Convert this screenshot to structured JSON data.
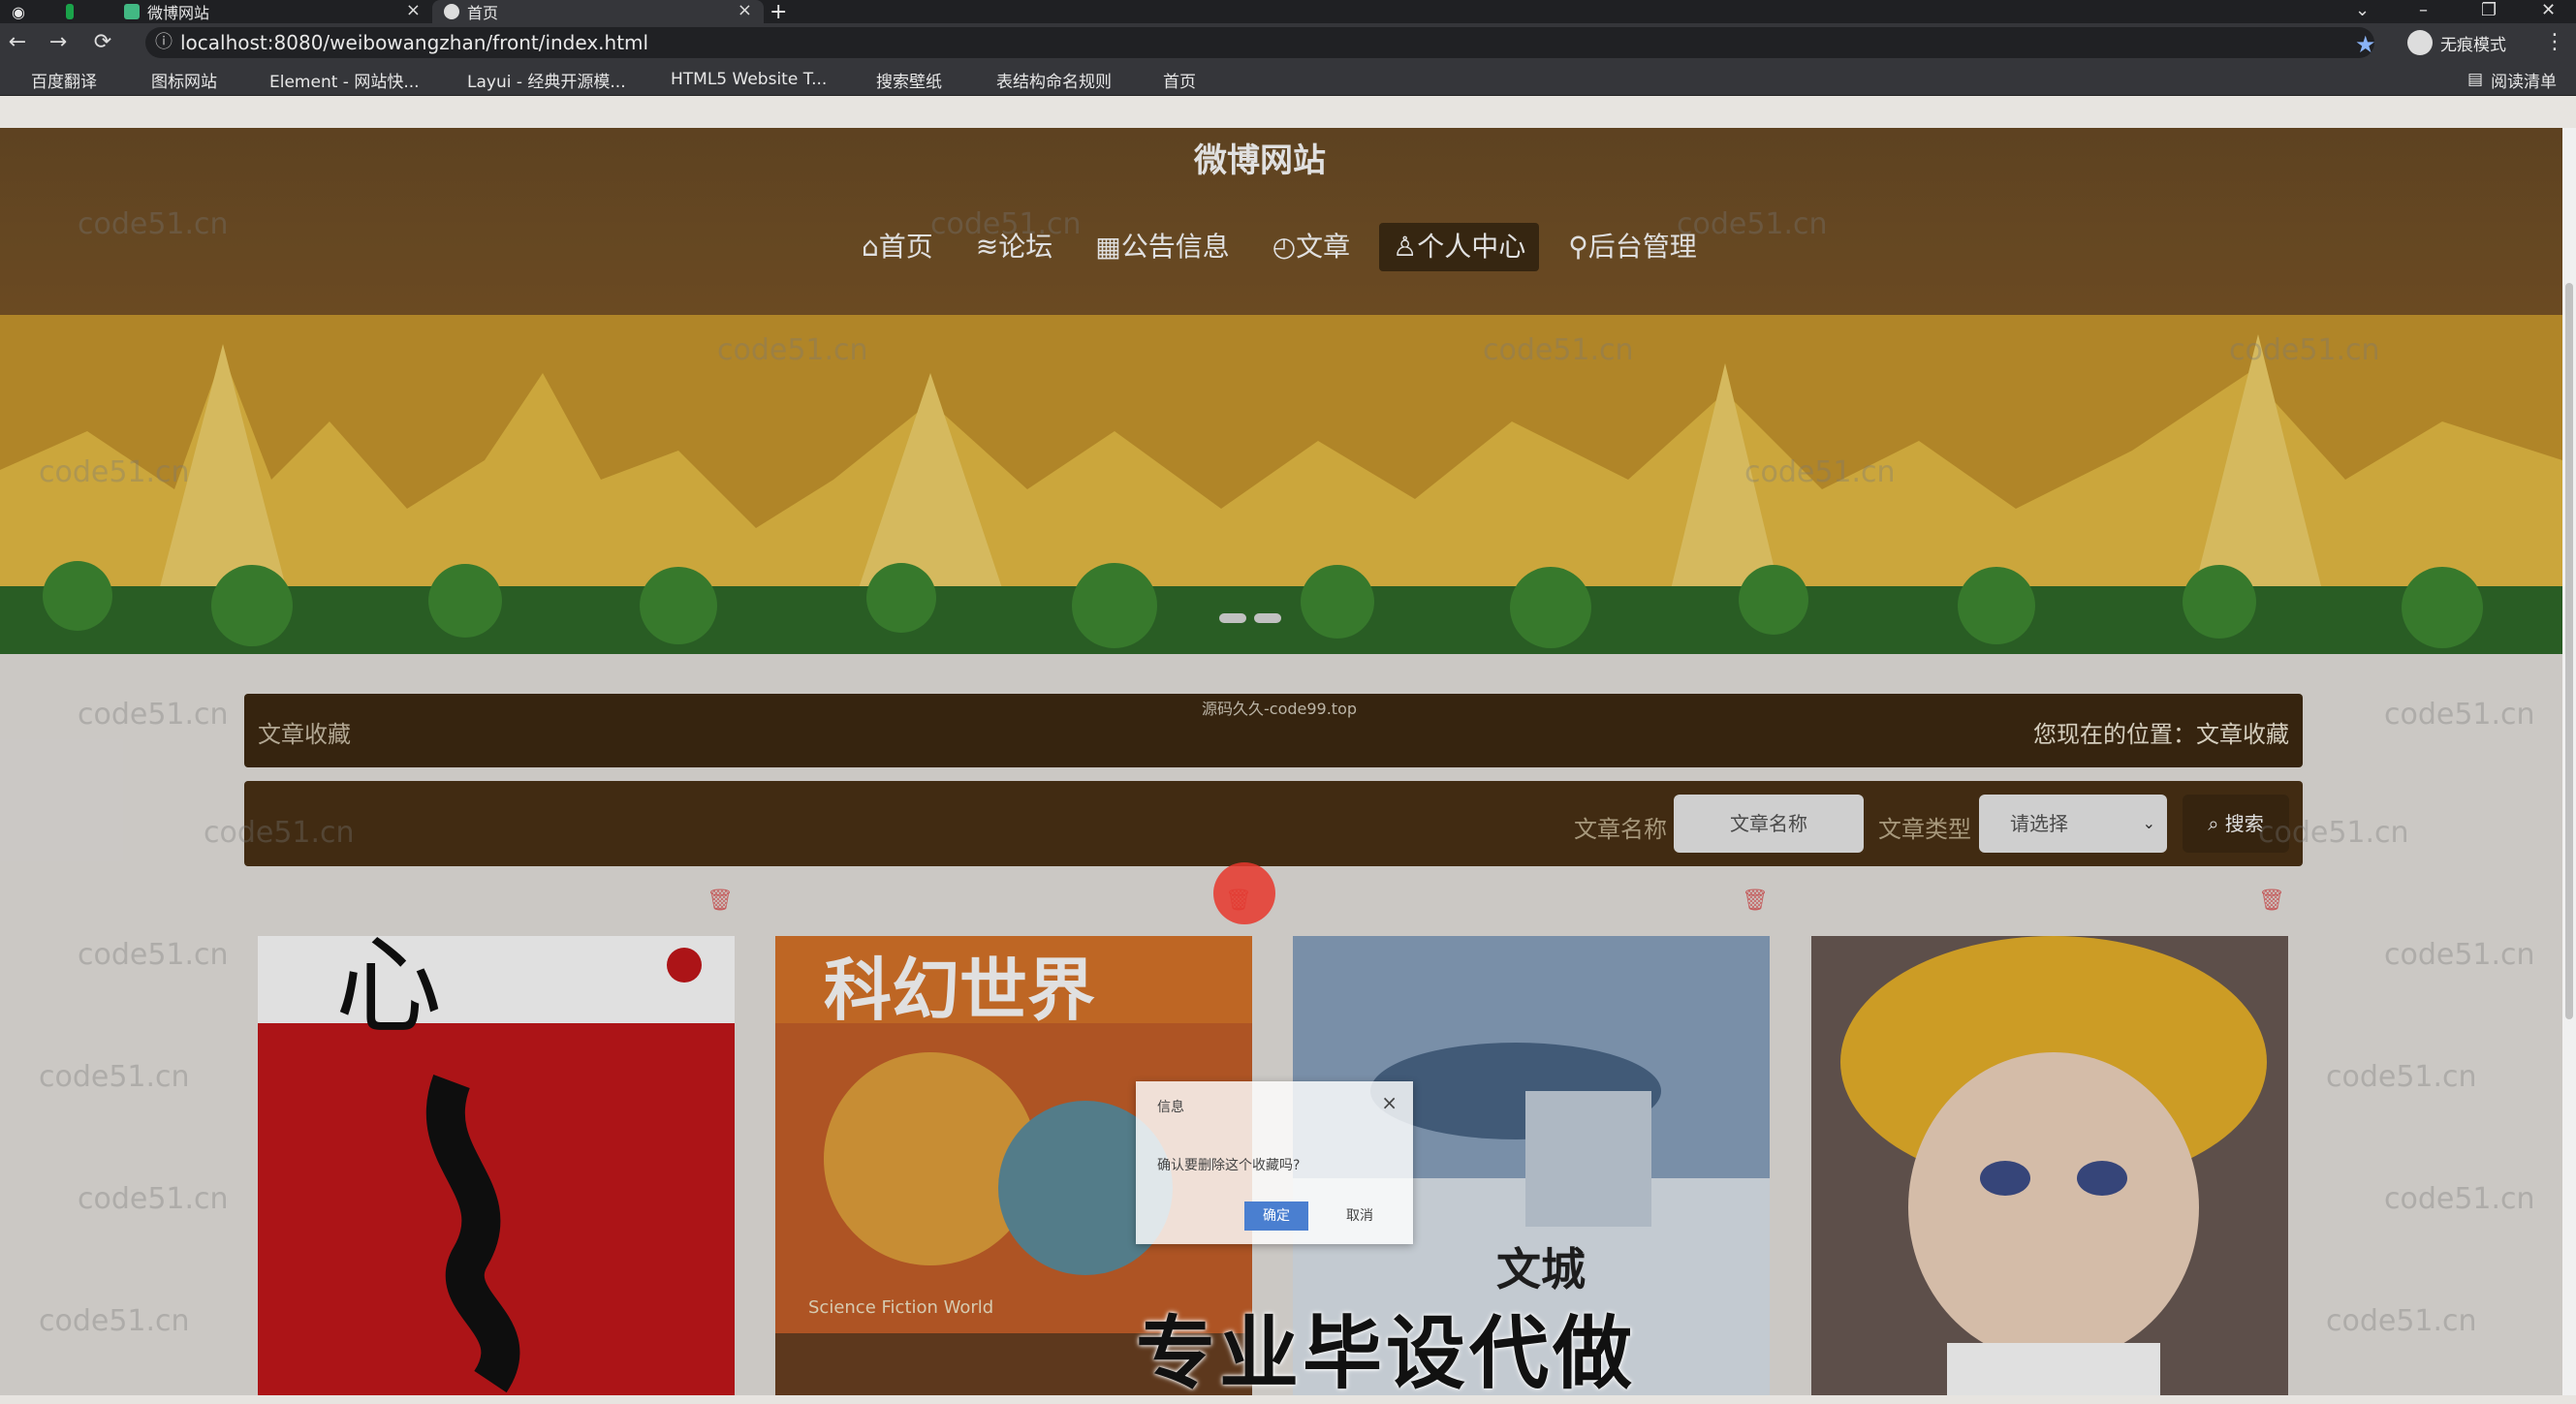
{
  "browser": {
    "tabs": [
      {
        "label": "微博网站",
        "icon": "vue-logo-icon"
      },
      {
        "label": "首页",
        "icon": "globe-icon"
      }
    ],
    "url": "localhost:8080/weibowangzhan/front/index.html",
    "profile_label": "无痕模式",
    "bookmarks": [
      {
        "label": "百度翻译",
        "color": "#2f6fd6"
      },
      {
        "label": "图标网站",
        "color": "#dddddd"
      },
      {
        "label": "Element - 网站快...",
        "color": "#409eff"
      },
      {
        "label": "Layui - 经典开源模...",
        "color": "#dddddd"
      },
      {
        "label": "HTML5 Website T...",
        "color": "#5b4fd6"
      },
      {
        "label": "搜索壁纸",
        "color": "#6a7ff0"
      },
      {
        "label": "表结构命名规则",
        "color": "#1aa34a"
      },
      {
        "label": "首页",
        "color": "#dddddd"
      }
    ],
    "reading_list": "阅读清单"
  },
  "site": {
    "title": "微博网站",
    "nav": [
      {
        "label": "⌂首页",
        "icon": "home-icon"
      },
      {
        "label": "≋论坛",
        "icon": "forum-icon"
      },
      {
        "label": "▦公告信息",
        "icon": "notice-icon"
      },
      {
        "label": "◴文章",
        "icon": "article-icon"
      },
      {
        "label": "♙个人中心",
        "icon": "user-icon"
      },
      {
        "label": "⚲后台管理",
        "icon": "admin-link-icon"
      }
    ],
    "active_nav": 4
  },
  "breadcrumb": {
    "title": "文章收藏",
    "location": "您现在的位置：文章收藏",
    "overlay_text": "源码久久-code99.top"
  },
  "search": {
    "name_label": "文章名称",
    "name_placeholder": "文章名称",
    "type_label": "文章类型",
    "type_value": "请选择",
    "button_label": "搜索"
  },
  "cards": [
    {
      "caption": "",
      "color": "#c4171b"
    },
    {
      "caption": "Science Fiction World",
      "color": "#c7602a"
    },
    {
      "caption": "文城",
      "color": "#8aa3c0"
    },
    {
      "caption": "",
      "color": "#e9b22b"
    }
  ],
  "dialog": {
    "title": "信息",
    "message": "确认要删除这个收藏吗?",
    "ok_label": "确定",
    "cancel_label": "取消"
  },
  "ad_text": "专业毕设代做",
  "watermark": "code51.cn"
}
